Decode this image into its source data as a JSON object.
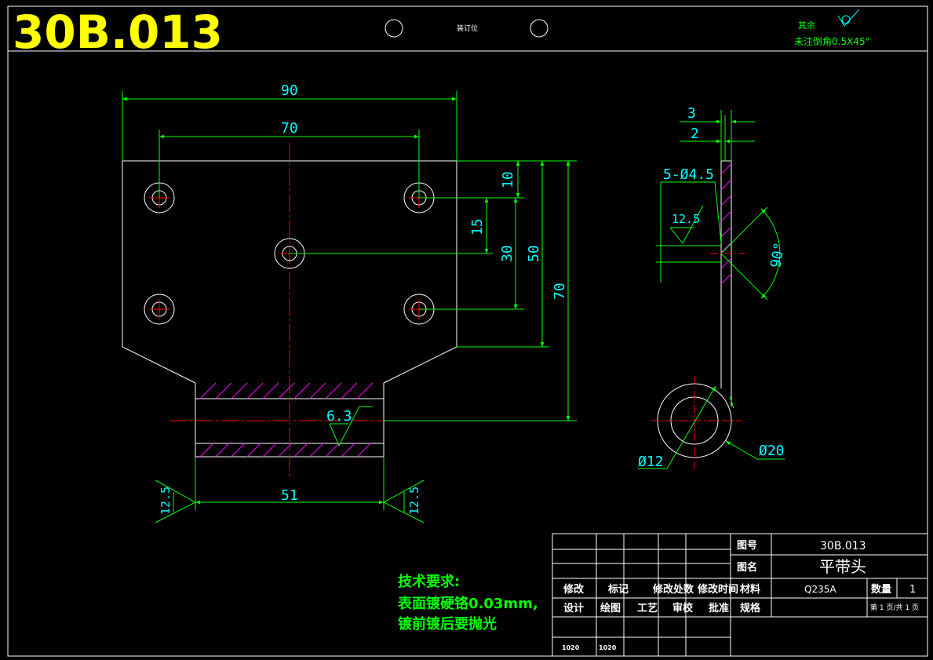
{
  "header": {
    "drawing_code": "30B.013",
    "binding_label": "装订位",
    "rough_label": "其余",
    "chamfer_note": "未注倒角0.5X45°"
  },
  "front_view": {
    "dim_90": "90",
    "dim_70_top": "70",
    "dim_10": "10",
    "dim_15": "15",
    "dim_30": "30",
    "dim_50": "50",
    "dim_70_right": "70",
    "dim_51": "51",
    "rough_6_3": "6.3",
    "rough_left": "12.5",
    "rough_right": "12.5"
  },
  "side_view": {
    "dim_3": "3",
    "dim_2": "2",
    "holes": "5-Ø4.5",
    "rough": "12.5",
    "angle": "90°",
    "dia_12": "Ø12",
    "dia_20": "Ø20"
  },
  "tech_req": {
    "title": "技术要求:",
    "line1": "表面镀硬铬0.03mm,",
    "line2": "镀前镀后要抛光"
  },
  "title_block": {
    "code_label": "图号",
    "code_value": "30B.013",
    "name_label": "图名",
    "name_value": "平带头",
    "material_label": "材料",
    "material_value": "Q235A",
    "qty_label": "数量",
    "qty_value": "1",
    "spec_label": "规格",
    "sheet": "第 1 页/共 1 页",
    "rev_cols": [
      "修改",
      "标记",
      "修改处数",
      "修改时间"
    ],
    "sign_cols": [
      "设计",
      "绘图",
      "工艺",
      "审校",
      "批准"
    ],
    "dates": [
      "1020",
      "1020"
    ]
  },
  "colors": {
    "background": "#000000",
    "outline": "#ffffff",
    "dimension": "#00ff00",
    "dim_text": "#00ffff",
    "center_line": "#ff0000",
    "hatch": "#ff00ff",
    "code_text": "#ffff00",
    "note_text": "#00ff00"
  }
}
